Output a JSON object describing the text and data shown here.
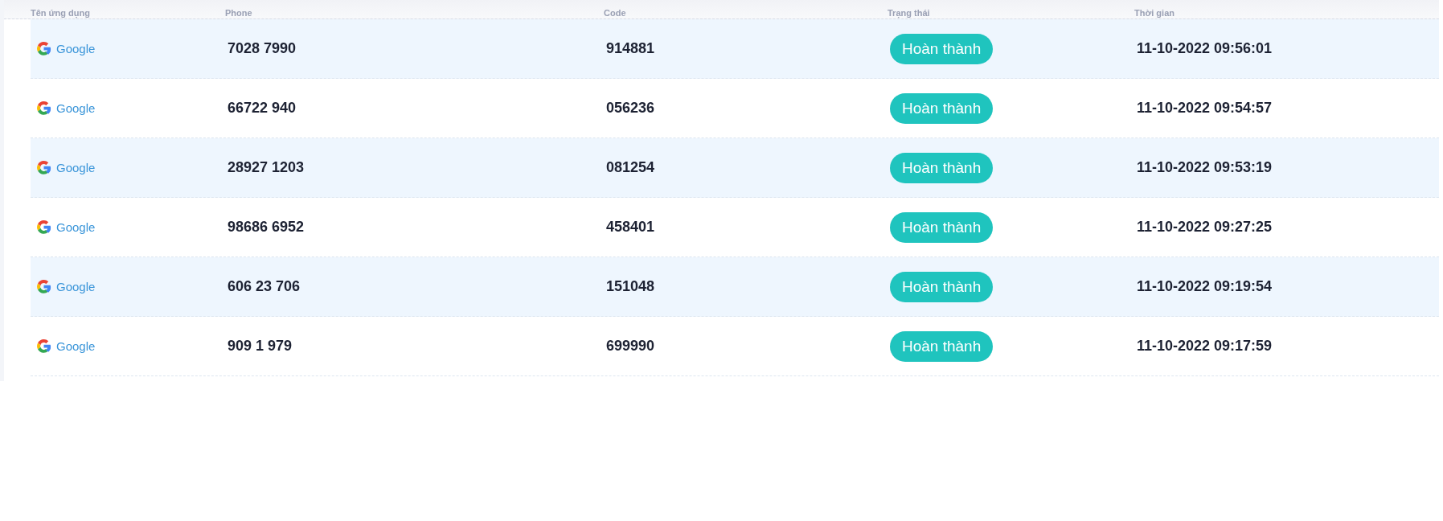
{
  "table": {
    "columns": [
      "Tên ứng dụng",
      "Phone",
      "Code",
      "Trạng thái",
      "Thời gian"
    ],
    "rows": [
      {
        "app": "Google",
        "phone": "7028 7990",
        "code": "914881",
        "status": {
          "label": "Hoàn thành",
          "kind": "done"
        },
        "time": "11-10-2022 09:56:01"
      },
      {
        "app": "Google",
        "phone": "66722 940",
        "code": "056236",
        "status": {
          "label": "Hoàn thành",
          "kind": "done"
        },
        "time": "11-10-2022 09:54:57"
      },
      {
        "app": "Google",
        "phone": "28927 1203",
        "code": "081254",
        "status": {
          "label": "Hoàn thành",
          "kind": "done"
        },
        "time": "11-10-2022 09:53:19"
      },
      {
        "app": "Google",
        "phone": "98686 6952",
        "code": "458401",
        "status": {
          "label": "Hoàn thành",
          "kind": "done"
        },
        "time": "11-10-2022 09:27:25"
      },
      {
        "app": "Google",
        "phone": "606 23 706",
        "code": "151048",
        "status": {
          "label": "Hoàn thành",
          "kind": "done"
        },
        "time": "11-10-2022 09:19:54"
      },
      {
        "app": "Google",
        "phone": "909 1 979",
        "code": "699990",
        "status": {
          "label": "Hoàn thành",
          "kind": "done"
        },
        "time": "11-10-2022 09:17:59"
      }
    ]
  }
}
